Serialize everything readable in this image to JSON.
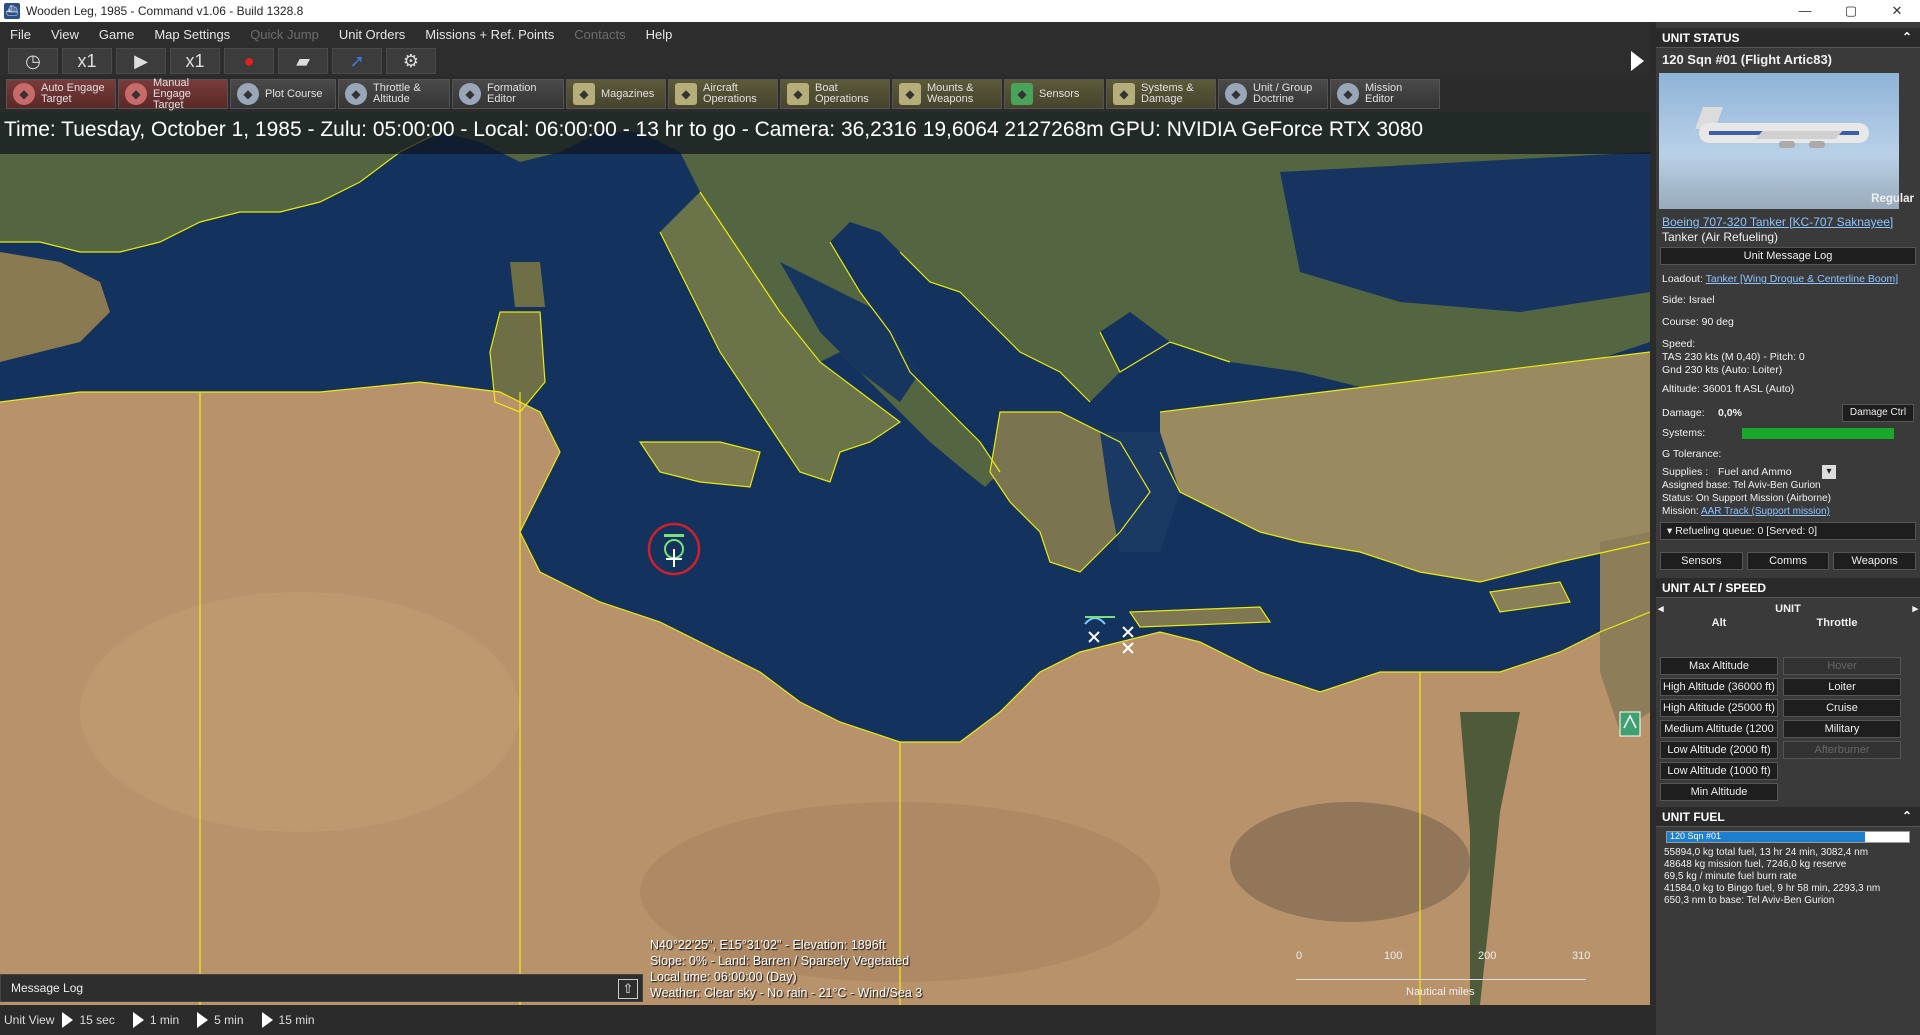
{
  "window": {
    "title": "Wooden Leg, 1985 - Command v1.06 - Build 1328.8",
    "btn_min": "—",
    "btn_max": "▢",
    "btn_close": "✕"
  },
  "menu": {
    "file": "File",
    "view": "View",
    "game": "Game",
    "map_settings": "Map Settings",
    "quick_jump": "Quick Jump",
    "unit_orders": "Unit Orders",
    "missions": "Missions + Ref. Points",
    "contacts": "Contacts",
    "help": "Help"
  },
  "time_controls": {
    "speed1": "x1",
    "speed2": "x1"
  },
  "toolbar": [
    {
      "line1": "Auto Engage",
      "line2": "Target",
      "style": "red",
      "icon": "crosshair-icon"
    },
    {
      "line1": "Manual",
      "line2": "Engage Target",
      "style": "red",
      "icon": "crosshair-icon"
    },
    {
      "line1": "Plot Course",
      "line2": "",
      "style": "",
      "icon": "plot-course-icon"
    },
    {
      "line1": "Throttle &",
      "line2": "Altitude",
      "style": "",
      "icon": "throttle-icon"
    },
    {
      "line1": "Formation",
      "line2": "Editor",
      "style": "",
      "icon": "formation-icon"
    },
    {
      "line1": "Magazines",
      "line2": "",
      "style": "olive",
      "icon": "magazines-icon"
    },
    {
      "line1": "Aircraft",
      "line2": "Operations",
      "style": "olive",
      "icon": "aircraft-icon"
    },
    {
      "line1": "Boat",
      "line2": "Operations",
      "style": "olive",
      "icon": "boat-icon"
    },
    {
      "line1": "Mounts &",
      "line2": "Weapons",
      "style": "olive",
      "icon": "mounts-icon"
    },
    {
      "line1": "Sensors",
      "line2": "",
      "style": "olive",
      "icon": "sensors-icon"
    },
    {
      "line1": "Systems &",
      "line2": "Damage",
      "style": "olive",
      "icon": "systems-icon"
    },
    {
      "line1": "Unit / Group",
      "line2": "Doctrine",
      "style": "",
      "icon": "doctrine-icon"
    },
    {
      "line1": "Mission",
      "line2": "Editor",
      "style": "",
      "icon": "mission-editor-icon"
    }
  ],
  "map": {
    "time_line": "Time: Tuesday, October 1, 1985 - Zulu: 05:00:00 - Local: 06:00:00 - 13 hr to go -  Camera: 36,2316 19,6064 2127268m  GPU: NVIDIA GeForce RTX 3080",
    "info": {
      "coords": "N40°22'25\", E15°31'02\" - Elevation: 1896ft",
      "slope": "Slope: 0%  - Land: Barren / Sparsely Vegetated",
      "local_time": "Local time: 06:00:00 (Day)",
      "weather": "Weather: Clear sky - No rain - 21°C - Wind/Sea 3"
    },
    "scale": {
      "t0": "0",
      "t1": "100",
      "t2": "200",
      "t3": "310",
      "unit": "Nautical miles"
    },
    "message_log": "Message Log",
    "colors": {
      "sea": "#14325e",
      "land": "#b8926a",
      "border": "#f2f20a"
    }
  },
  "bottombar": {
    "unit_view": "Unit View",
    "s1": "15 sec",
    "s2": "1 min",
    "s3": "5 min",
    "s4": "15 min"
  },
  "panel": {
    "unit_status_head": "UNIT STATUS",
    "unit_name": "120 Sqn #01 (Flight Artic83)",
    "proficiency": "Regular",
    "aircraft_link": "Boeing 707-320 Tanker [KC-707 Saknayee]",
    "role": "Tanker (Air Refueling)",
    "msg_log_btn": "Unit Message Log",
    "loadout_label": "Loadout:",
    "loadout_link": "Tanker [Wing Drogue & Centerline Boom]",
    "side": "Side: Israel",
    "course": "Course: 90 deg",
    "speed_label": "Speed:",
    "tas": "TAS 230 kts (M 0,40) - Pitch: 0",
    "gnd": "Gnd 230 kts (Auto: Loiter)",
    "altitude": "Altitude: 36001 ft ASL (Auto)",
    "damage_label": "Damage:",
    "damage_val": "0,0%",
    "damage_btn": "Damage Ctrl",
    "systems_label": "Systems:",
    "systems_level": 1.0,
    "gtol": "G Tolerance:",
    "supplies_label": "Supplies :",
    "supplies_val": "Fuel and Ammo",
    "assigned": "Assigned base: Tel Aviv-Ben Gurion",
    "status": "Status: On Support Mission (Airborne)",
    "mission_label": "Mission:",
    "mission_link": "AAR Track (Support mission)",
    "refuel_queue": "Refueling queue: 0 [Served: 0]",
    "tab_sensors": "Sensors",
    "tab_comms": "Comms",
    "tab_weapons": "Weapons",
    "alt_head": "UNIT ALT / SPEED",
    "alt_unit": "UNIT",
    "alt_col": "Alt",
    "thr_col": "Throttle",
    "alt_buttons": [
      "Max Altitude",
      "High Altitude (36000 ft)",
      "High Altitude (25000 ft)",
      "Medium Altitude (1200",
      "Low Altitude (2000 ft)",
      "Low Altitude (1000 ft)",
      "Min Altitude"
    ],
    "thr_buttons": [
      "Hover",
      "Loiter",
      "Cruise",
      "Military",
      "Afterburner"
    ],
    "fuel_head": "UNIT FUEL",
    "fuel_bar_label": "120 Sqn #01",
    "fuel_level": 0.82,
    "fuel_lines": [
      "55894,0 kg total fuel, 13 hr 24 min, 3082,4 nm",
      "48648 kg mission fuel, 7246,0 kg reserve",
      "69,5 kg / minute fuel burn rate",
      "41584,0 kg to Bingo fuel, 9 hr 58 min, 2293,3 nm",
      "650,3 nm to base: Tel Aviv-Ben Gurion"
    ]
  }
}
